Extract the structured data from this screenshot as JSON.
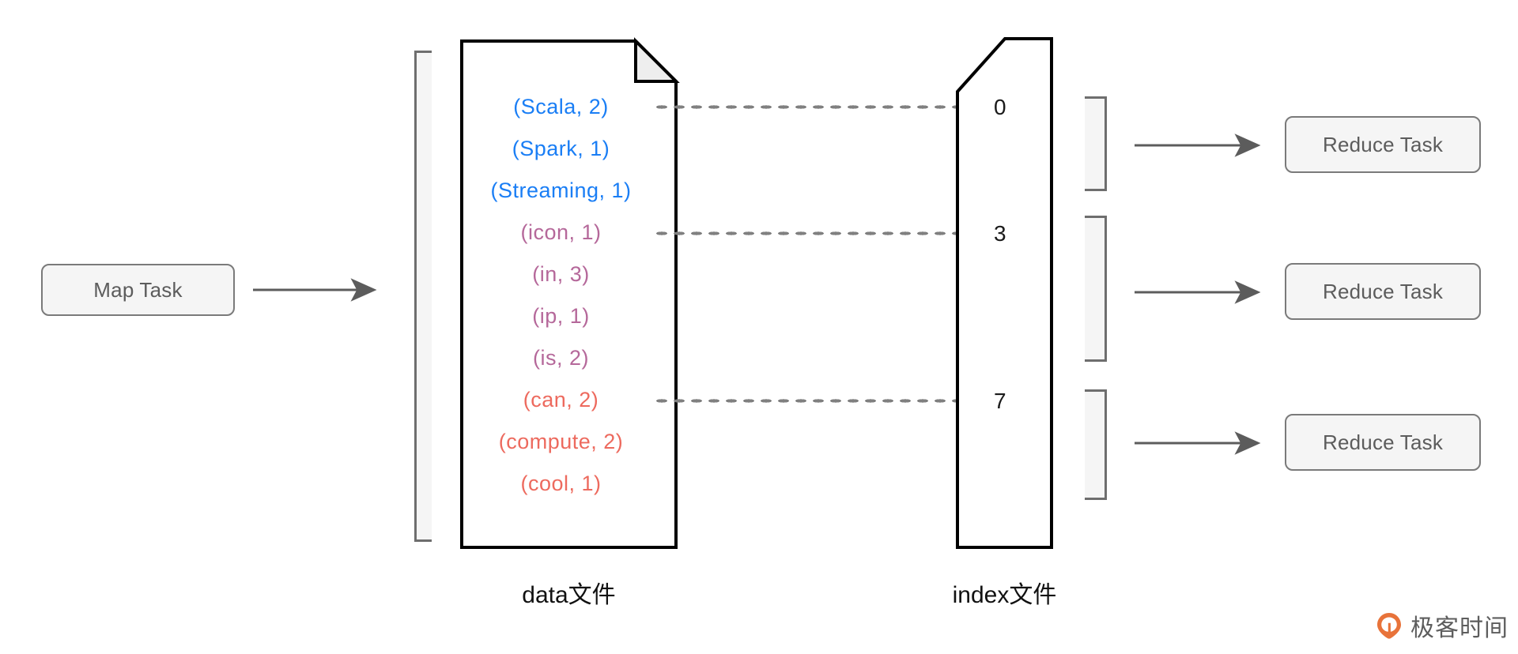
{
  "diagram": {
    "title": "Spark Shuffle Map Task output data file and index file",
    "map_task": {
      "label": "Map Task"
    },
    "reduce_tasks": [
      {
        "label": "Reduce Task"
      },
      {
        "label": "Reduce Task"
      },
      {
        "label": "Reduce Task"
      }
    ],
    "data_file": {
      "caption": "data文件",
      "records": [
        {
          "text": "(Scala,  2)",
          "group": "blue"
        },
        {
          "text": "(Spark,  1)",
          "group": "blue"
        },
        {
          "text": "(Streaming,  1)",
          "group": "blue"
        },
        {
          "text": "(icon,  1)",
          "group": "mauve"
        },
        {
          "text": "(in,  3)",
          "group": "mauve"
        },
        {
          "text": "(ip,  1)",
          "group": "mauve"
        },
        {
          "text": "(is,  2)",
          "group": "mauve"
        },
        {
          "text": "(can,  2)",
          "group": "red"
        },
        {
          "text": "(compute,  2)",
          "group": "red"
        },
        {
          "text": "(cool,  1)",
          "group": "red"
        }
      ]
    },
    "index_file": {
      "caption": "index文件",
      "offsets": [
        {
          "value": "0"
        },
        {
          "value": "3"
        },
        {
          "value": "7"
        }
      ]
    },
    "colors": {
      "blue": "#1a7ef5",
      "mauve": "#b5689a",
      "red": "#ed6a5e",
      "box_border": "#7a7a7a",
      "box_fill": "#f5f5f5",
      "arrow": "#5c5c5c",
      "file_outline": "#000000",
      "bracket": "#6e6e6e",
      "watermark_accent": "#e8733a"
    }
  },
  "watermark": {
    "text": "极客时间"
  }
}
